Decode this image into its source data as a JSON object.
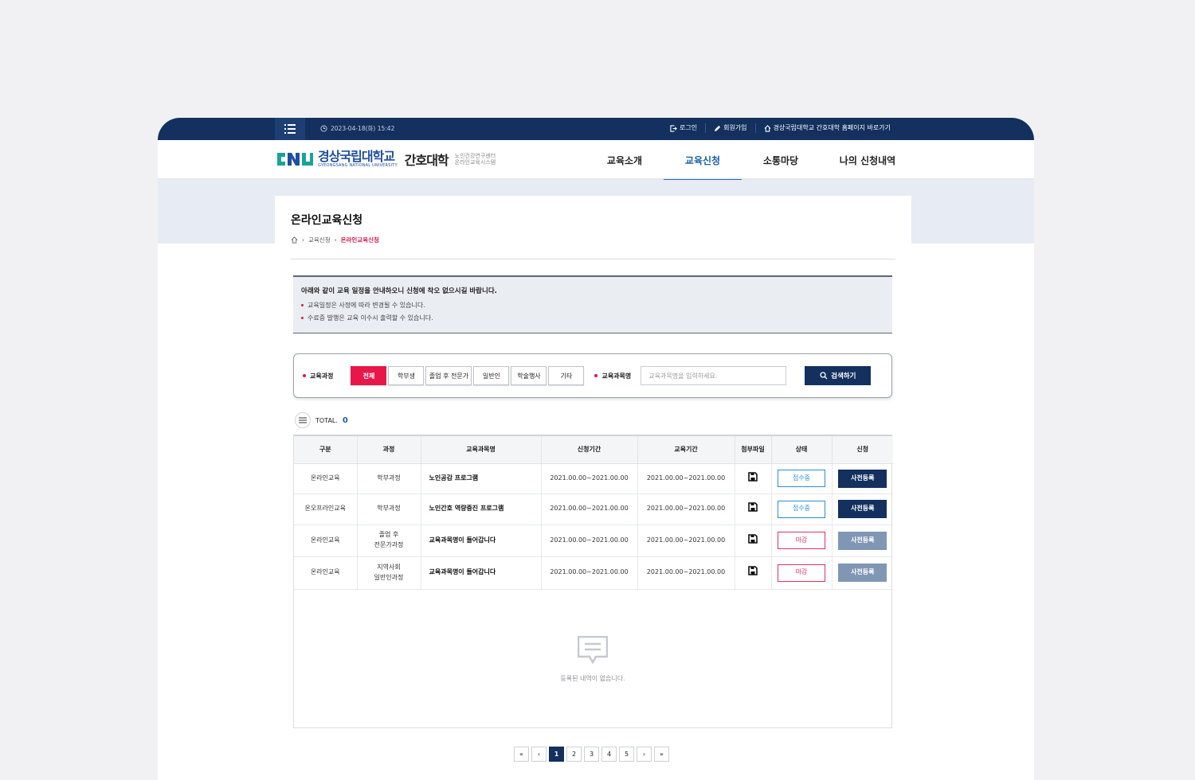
{
  "topbar": {
    "datetime": "2023-04-18(화) 15:42",
    "login": "로그인",
    "signup": "회원가입",
    "homepage": "경상국립대학교 간호대학 홈페이지 바로가기"
  },
  "logo": {
    "univ_ko": "경상국립대학교",
    "univ_en": "GYEONGSANG NATIONAL UNIVERSITY",
    "college": "간호대학",
    "center_line1": "노인건강연구센터",
    "center_line2": "온라인교육시스템"
  },
  "gnb": [
    "교육소개",
    "교육신청",
    "소통마당",
    "나의 신청내역"
  ],
  "page": {
    "title": "온라인교육신청",
    "breadcrumb": [
      "교육신청",
      "온라인교육신청"
    ]
  },
  "notice": {
    "title": "아래와 같이 교육 일정을 안내하오니 신청에 착오 없으시길 바랍니다.",
    "items": [
      "교육일정은 사정에 따라 변경될 수 있습니다.",
      "수료증 발행은 교육 이수시 출력할 수 있습니다."
    ]
  },
  "filter": {
    "label": "교육과정",
    "chips": [
      "전체",
      "학부생",
      "졸업 후 전문가",
      "일반인",
      "학술행사",
      "기타"
    ],
    "name_label": "교육과목명",
    "search_placeholder": "교육과목명을 입력하세요.",
    "search_button": "검색하기"
  },
  "total": {
    "label": "TOTAL.",
    "count": "0"
  },
  "table": {
    "headers": [
      "구분",
      "과정",
      "교육과목명",
      "신청기간",
      "교육기간",
      "첨부파일",
      "상태",
      "신청"
    ],
    "rows": [
      {
        "type": "온라인교육",
        "course": "학부과정",
        "course2": "",
        "name": "노인공감 프로그램",
        "apply": "2021.00.00~2021.00.00",
        "edu": "2021.00.00~2021.00.00",
        "status": "접수중",
        "status_kind": "open",
        "btn": "사전등록",
        "btn_kind": "en"
      },
      {
        "type": "온오프라인교육",
        "course": "학부과정",
        "course2": "",
        "name": "노인간호 역량증진 프로그램",
        "apply": "2021.00.00~2021.00.00",
        "edu": "2021.00.00~2021.00.00",
        "status": "접수중",
        "status_kind": "open",
        "btn": "사전등록",
        "btn_kind": "en"
      },
      {
        "type": "온라인교육",
        "course": "졸업 후",
        "course2": "전문가과정",
        "name": "교육과목명이 들어갑니다",
        "apply": "2021.00.00~2021.00.00",
        "edu": "2021.00.00~2021.00.00",
        "status": "마감",
        "status_kind": "closed",
        "btn": "사전등록",
        "btn_kind": "dis"
      },
      {
        "type": "온라인교육",
        "course": "지역사회",
        "course2": "일반인과정",
        "name": "교육과목명이 들어갑니다",
        "apply": "2021.00.00~2021.00.00",
        "edu": "2021.00.00~2021.00.00",
        "status": "마감",
        "status_kind": "closed",
        "btn": "사전등록",
        "btn_kind": "dis"
      }
    ],
    "empty_text": "등록된 내역이 없습니다."
  },
  "pager": {
    "pages": [
      "1",
      "2",
      "3",
      "4",
      "5"
    ],
    "current": "1"
  },
  "colors": {
    "navy": "#13305e",
    "accent": "#e8174a",
    "link_blue": "#1a5fa8"
  }
}
